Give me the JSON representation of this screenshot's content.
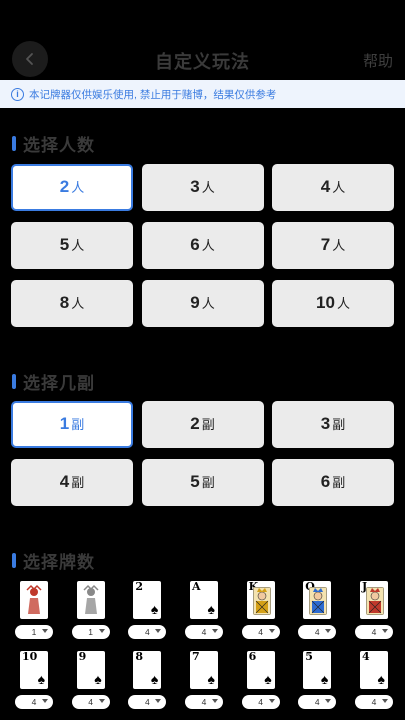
{
  "header": {
    "title": "自定义玩法",
    "help": "帮助"
  },
  "notice": {
    "text": "本记牌器仅供娱乐使用, 禁止用于赌博，结果仅供参考"
  },
  "players": {
    "title": "选择人数",
    "unit": "人",
    "selected": "2",
    "options": [
      "2",
      "3",
      "4",
      "5",
      "6",
      "7",
      "8",
      "9",
      "10"
    ]
  },
  "decks": {
    "title": "选择几副",
    "unit": "副",
    "selected": "1",
    "options": [
      "1",
      "2",
      "3",
      "4",
      "5",
      "6"
    ]
  },
  "cards": {
    "title": "选择牌数",
    "row1": [
      {
        "name": "big-joker",
        "rank": "",
        "kind": "joker",
        "color": "#c0392b",
        "count": "1"
      },
      {
        "name": "small-joker",
        "rank": "",
        "kind": "joker",
        "color": "#888888",
        "count": "1"
      },
      {
        "name": "two",
        "rank": "2",
        "kind": "pip",
        "count": "4"
      },
      {
        "name": "ace",
        "rank": "A",
        "kind": "pip",
        "count": "4"
      },
      {
        "name": "king",
        "rank": "K",
        "kind": "face",
        "color": "#d4a017",
        "count": "4"
      },
      {
        "name": "queen",
        "rank": "Q",
        "kind": "face",
        "color": "#2d6bd1",
        "count": "4"
      },
      {
        "name": "jack",
        "rank": "J",
        "kind": "face",
        "color": "#c0392b",
        "count": "4"
      }
    ],
    "row2": [
      {
        "name": "ten",
        "rank": "10",
        "kind": "pip",
        "count": "4"
      },
      {
        "name": "nine",
        "rank": "9",
        "kind": "pip",
        "count": "4"
      },
      {
        "name": "eight",
        "rank": "8",
        "kind": "pip",
        "count": "4"
      },
      {
        "name": "seven",
        "rank": "7",
        "kind": "pip",
        "count": "4"
      },
      {
        "name": "six",
        "rank": "6",
        "kind": "pip",
        "count": "4"
      },
      {
        "name": "five",
        "rank": "5",
        "kind": "pip",
        "count": "4"
      },
      {
        "name": "four",
        "rank": "4",
        "kind": "pip",
        "count": "4"
      }
    ],
    "suit_symbol": "♠"
  }
}
